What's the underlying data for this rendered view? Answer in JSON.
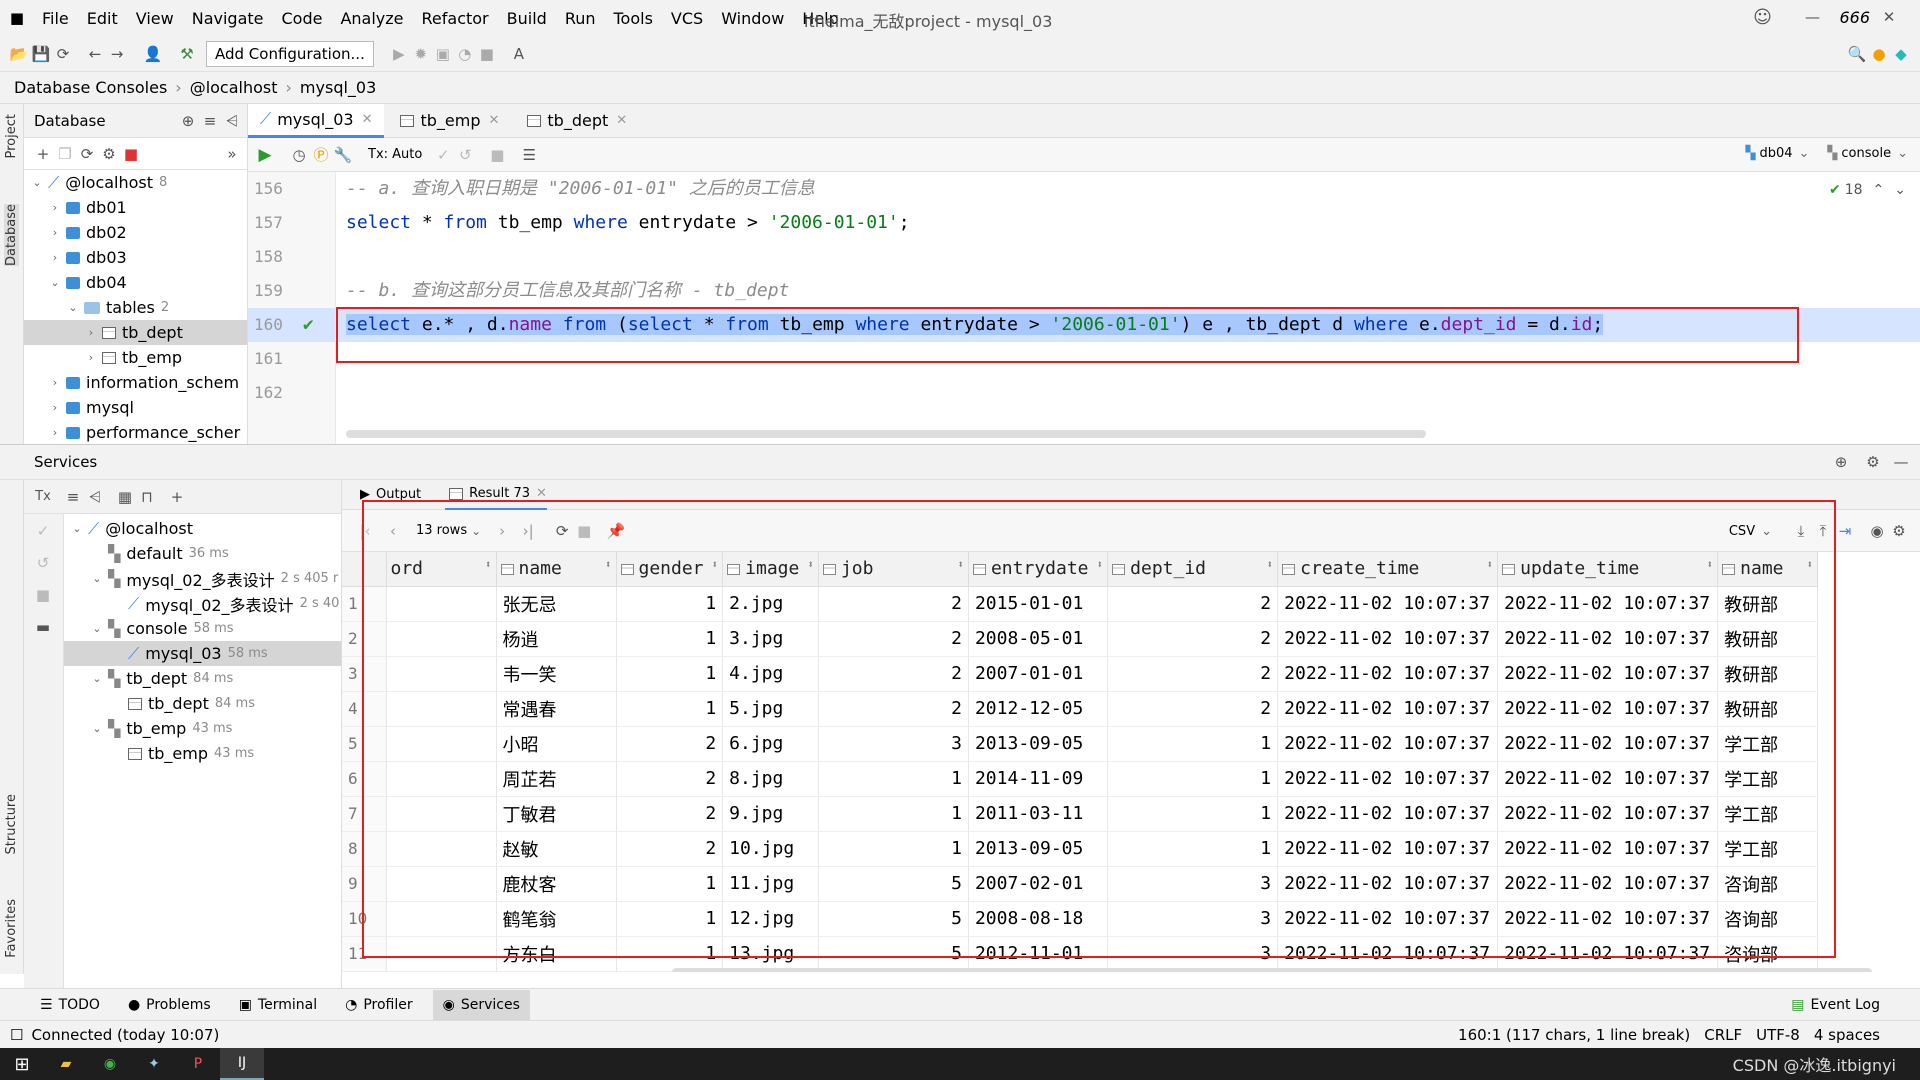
{
  "window": {
    "title": "itheima_无敌project - mysql_03",
    "menu": [
      "File",
      "Edit",
      "View",
      "Navigate",
      "Code",
      "Analyze",
      "Refactor",
      "Build",
      "Run",
      "Tools",
      "VCS",
      "Window",
      "Help"
    ],
    "right_badge": "666"
  },
  "toolbar": {
    "add_config_label": "Add Configuration..."
  },
  "breadcrumb": {
    "items": [
      "Database Consoles",
      "@localhost",
      "mysql_03"
    ]
  },
  "left_stripe": {
    "project": "Project",
    "database": "Database",
    "structure": "Structure",
    "favorites": "Favorites"
  },
  "db_panel": {
    "title": "Database",
    "tree": [
      {
        "label": "@localhost",
        "count": "8",
        "level": 0
      },
      {
        "label": "db01",
        "level": 1
      },
      {
        "label": "db02",
        "level": 1
      },
      {
        "label": "db03",
        "level": 1
      },
      {
        "label": "db04",
        "level": 1
      },
      {
        "label": "tables",
        "count": "2",
        "level": 2
      },
      {
        "label": "tb_dept",
        "level": 3
      },
      {
        "label": "tb_emp",
        "level": 3
      },
      {
        "label": "information_schem",
        "level": 1
      },
      {
        "label": "mysql",
        "level": 1
      },
      {
        "label": "performance_scher",
        "level": 1
      }
    ]
  },
  "editor": {
    "tabs": [
      "mysql_03",
      "tb_emp",
      "tb_dept"
    ],
    "tx_label": "Tx: Auto",
    "db_selector": "db04",
    "console_selector": "console",
    "inspection_count": "18",
    "line_numbers": [
      "156",
      "157",
      "158",
      "159",
      "160",
      "161",
      "162"
    ],
    "lines": {
      "l156": "-- a. 查询入职日期是 \"2006-01-01\" 之后的员工信息",
      "l157_kw1": "select",
      "l157_a": " * ",
      "l157_kw2": "from",
      "l157_b": " tb_emp ",
      "l157_kw3": "where",
      "l157_c": " entrydate > ",
      "l157_str": "'2006-01-01'",
      "l157_d": ";",
      "l159": "-- b. 查询这部分员工信息及其部门名称 - tb_dept",
      "l160_kw1": "select",
      "l160_a": " e.* , d.",
      "l160_f1": "name",
      "l160_b": " ",
      "l160_kw2": "from",
      "l160_c": " (",
      "l160_kw3": "select",
      "l160_d": " * ",
      "l160_kw4": "from",
      "l160_e": " tb_emp ",
      "l160_kw5": "where",
      "l160_f": " entrydate > ",
      "l160_str": "'2006-01-01'",
      "l160_g": ") e , tb_dept d ",
      "l160_kw6": "where",
      "l160_h": " e.",
      "l160_f2": "dept_id",
      "l160_i": " = d.",
      "l160_f3": "id",
      "l160_j": ";"
    }
  },
  "services": {
    "title": "Services",
    "tree": [
      {
        "label": "@localhost",
        "time": "",
        "level": 0
      },
      {
        "label": "default",
        "time": "36 ms",
        "level": 1
      },
      {
        "label": "mysql_02_多表设计",
        "time": "2 s 405 r",
        "level": 1
      },
      {
        "label": "mysql_02_多表设计",
        "time": "2 s 40",
        "level": 2
      },
      {
        "label": "console",
        "time": "58 ms",
        "level": 1
      },
      {
        "label": "mysql_03",
        "time": "58 ms",
        "level": 2
      },
      {
        "label": "tb_dept",
        "time": "84 ms",
        "level": 1
      },
      {
        "label": "tb_dept",
        "time": "84 ms",
        "level": 2
      },
      {
        "label": "tb_emp",
        "time": "43 ms",
        "level": 1
      },
      {
        "label": "tb_emp",
        "time": "43 ms",
        "level": 2
      }
    ],
    "result_tabs": [
      "Output",
      "Result 73"
    ],
    "rows_label": "13 rows",
    "export_format": "CSV",
    "columns": [
      "ord",
      "name",
      "gender",
      "image",
      "job",
      "entrydate",
      "dept_id",
      "create_time",
      "update_time",
      "name"
    ],
    "rows": [
      [
        "1",
        "张无忌",
        "1",
        "2.jpg",
        "2",
        "2015-01-01",
        "2",
        "2022-11-02 10:07:37",
        "2022-11-02 10:07:37",
        "教研部"
      ],
      [
        "2",
        "杨逍",
        "1",
        "3.jpg",
        "2",
        "2008-05-01",
        "2",
        "2022-11-02 10:07:37",
        "2022-11-02 10:07:37",
        "教研部"
      ],
      [
        "3",
        "韦一笑",
        "1",
        "4.jpg",
        "2",
        "2007-01-01",
        "2",
        "2022-11-02 10:07:37",
        "2022-11-02 10:07:37",
        "教研部"
      ],
      [
        "4",
        "常遇春",
        "1",
        "5.jpg",
        "2",
        "2012-12-05",
        "2",
        "2022-11-02 10:07:37",
        "2022-11-02 10:07:37",
        "教研部"
      ],
      [
        "5",
        "小昭",
        "2",
        "6.jpg",
        "3",
        "2013-09-05",
        "1",
        "2022-11-02 10:07:37",
        "2022-11-02 10:07:37",
        "学工部"
      ],
      [
        "6",
        "周芷若",
        "2",
        "8.jpg",
        "1",
        "2014-11-09",
        "1",
        "2022-11-02 10:07:37",
        "2022-11-02 10:07:37",
        "学工部"
      ],
      [
        "7",
        "丁敏君",
        "2",
        "9.jpg",
        "1",
        "2011-03-11",
        "1",
        "2022-11-02 10:07:37",
        "2022-11-02 10:07:37",
        "学工部"
      ],
      [
        "8",
        "赵敏",
        "2",
        "10.jpg",
        "1",
        "2013-09-05",
        "1",
        "2022-11-02 10:07:37",
        "2022-11-02 10:07:37",
        "学工部"
      ],
      [
        "9",
        "鹿杖客",
        "1",
        "11.jpg",
        "5",
        "2007-02-01",
        "3",
        "2022-11-02 10:07:37",
        "2022-11-02 10:07:37",
        "咨询部"
      ],
      [
        "10",
        "鹤笔翁",
        "1",
        "12.jpg",
        "5",
        "2008-08-18",
        "3",
        "2022-11-02 10:07:37",
        "2022-11-02 10:07:37",
        "咨询部"
      ],
      [
        "11",
        "方东白",
        "1",
        "13.jpg",
        "5",
        "2012-11-01",
        "3",
        "2022-11-02 10:07:37",
        "2022-11-02 10:07:37",
        "咨询部"
      ]
    ]
  },
  "bottom_tabs": [
    "TODO",
    "Problems",
    "Terminal",
    "Profiler",
    "Services"
  ],
  "event_log": "Event Log",
  "status": {
    "connected": "Connected (today 10:07)",
    "position": "160:1 (117 chars, 1 line break)",
    "line_sep": "CRLF",
    "encoding": "UTF-8",
    "indent": "4 spaces"
  },
  "taskbar": {
    "watermark": "CSDN @冰逸.itbignyi"
  },
  "colors": {
    "accent": "#4a86e8",
    "highlight": "#e02020",
    "selection": "#a6c8ff",
    "keyword": "#0033b3",
    "string": "#067d17"
  }
}
